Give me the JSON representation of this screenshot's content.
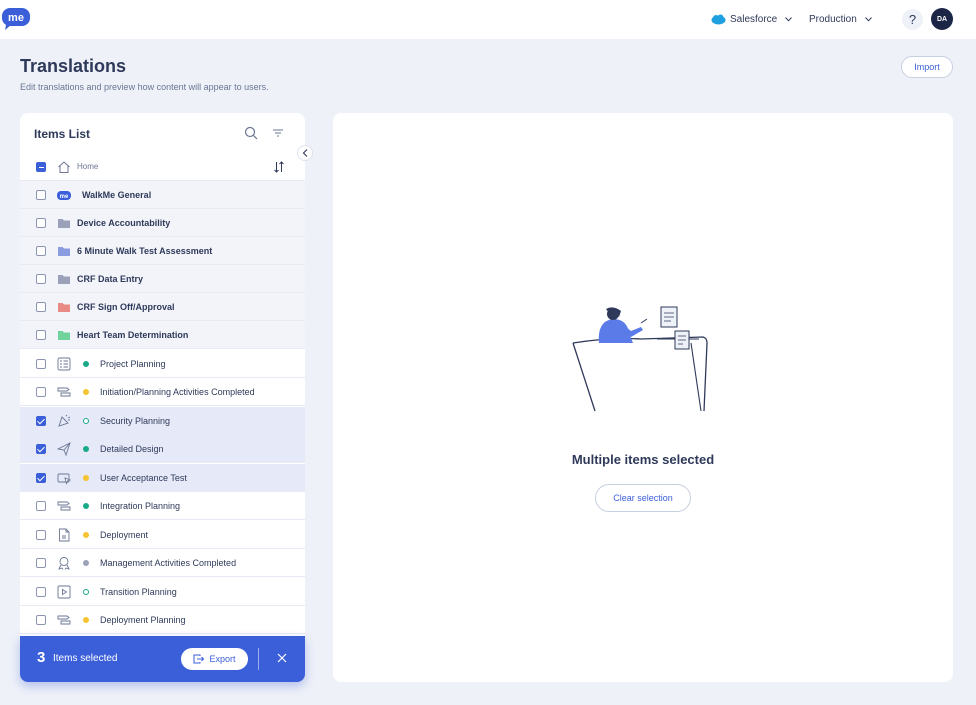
{
  "topbar": {
    "logo_icon": "walkme-logo",
    "system_label": "Salesforce",
    "environment_label": "Production",
    "help_label": "?",
    "avatar_initials": "DA",
    "accent": "#3b5fd9"
  },
  "header": {
    "title": "Translations",
    "subtitle": "Edit translations and preview how content will appear to users.",
    "import_label": "Import"
  },
  "items_panel": {
    "title": "Items List",
    "home_label": "Home",
    "folders": [
      {
        "label": "WalkMe General",
        "icon": "walkme-logo-icon",
        "color": "#3b5fd9"
      },
      {
        "label": "Device Accountability",
        "icon": "folder-icon",
        "color": "#9aa1b9"
      },
      {
        "label": "6 Minute Walk Test Assessment",
        "icon": "folder-icon",
        "color": "#8c9ce0"
      },
      {
        "label": "CRF Data Entry",
        "icon": "folder-icon",
        "color": "#9aa1b9"
      },
      {
        "label": "CRF Sign Off/Approval",
        "icon": "folder-icon",
        "color": "#e88a86"
      },
      {
        "label": "Heart Team Determination",
        "icon": "folder-icon",
        "color": "#6fd39b"
      }
    ],
    "items": [
      {
        "label": "Project Planning",
        "icon": "checklist-icon",
        "status_color": "#19a88a",
        "status": "published",
        "checked": false
      },
      {
        "label": "Initiation/Planning Activities Completed",
        "icon": "flow-icon",
        "status_color": "#f5c430",
        "status": "draft",
        "checked": false
      },
      {
        "label": "Security Planning",
        "icon": "shoutout-icon",
        "status_color": "#19a88a",
        "status": "hollow",
        "checked": true
      },
      {
        "label": "Detailed Design",
        "icon": "launcher-icon",
        "status_color": "#19a88a",
        "status": "published",
        "checked": true
      },
      {
        "label": "User Acceptance Test",
        "icon": "smarttip-icon",
        "status_color": "#f5c430",
        "status": "draft",
        "checked": true
      },
      {
        "label": "Integration Planning",
        "icon": "flow-icon",
        "status_color": "#19a88a",
        "status": "published",
        "checked": false
      },
      {
        "label": "Deployment",
        "icon": "document-icon",
        "status_color": "#f5c430",
        "status": "draft",
        "checked": false
      },
      {
        "label": "Management Activities Completed",
        "icon": "survey-icon",
        "status_color": "#9aa1b9",
        "status": "archived",
        "checked": false
      },
      {
        "label": "Transition Planning",
        "icon": "video-icon",
        "status_color": "#19a88a",
        "status": "hollow",
        "checked": false
      },
      {
        "label": "Deployment Planning",
        "icon": "flow-icon",
        "status_color": "#f5c430",
        "status": "draft",
        "checked": false
      }
    ]
  },
  "selection_bar": {
    "count": "3",
    "text": "Items selected",
    "export_label": "Export"
  },
  "main": {
    "title": "Multiple items selected",
    "clear_label": "Clear selection"
  }
}
